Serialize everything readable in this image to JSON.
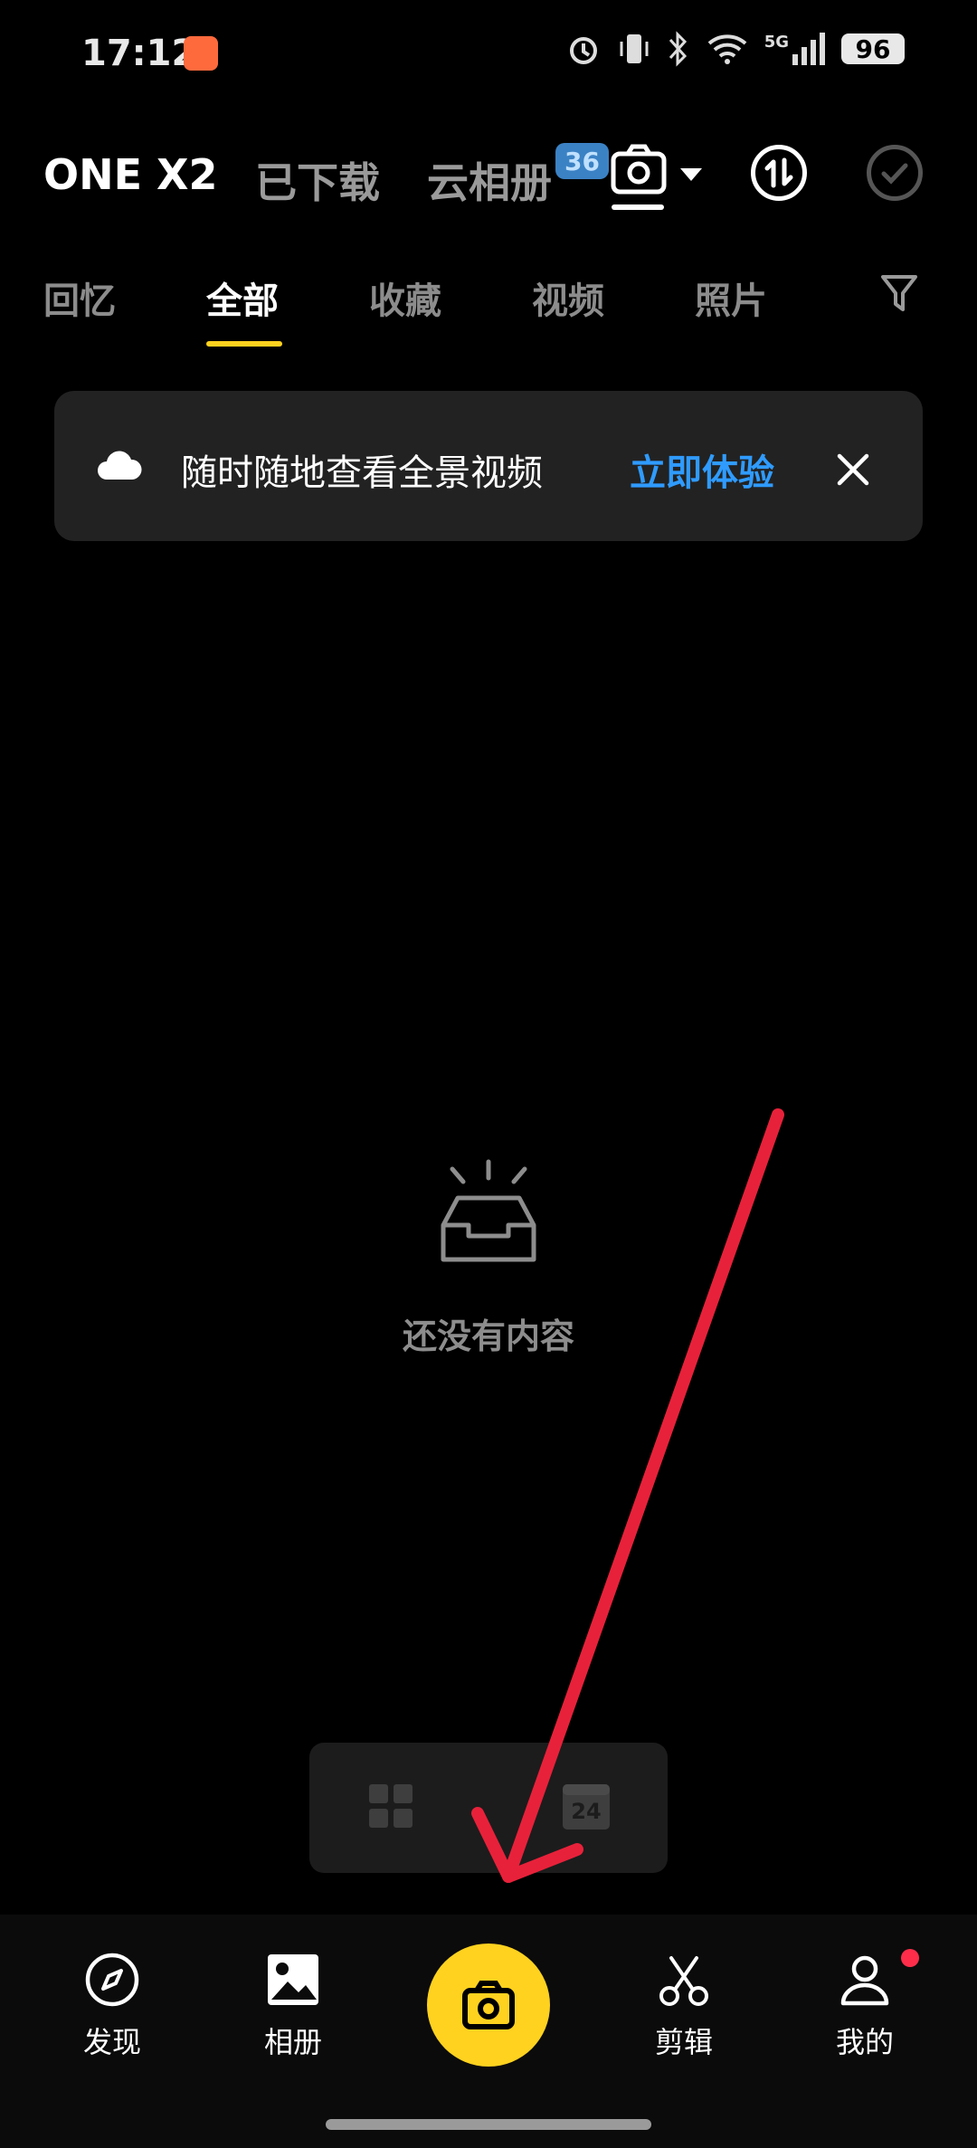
{
  "status": {
    "time": "17:12",
    "battery": "96",
    "network": "5G"
  },
  "header": {
    "tabs": [
      "ONE X2",
      "已下载",
      "云相册"
    ],
    "cloud_badge": "36"
  },
  "subtabs": [
    "回忆",
    "全部",
    "收藏",
    "视频",
    "照片"
  ],
  "banner": {
    "text": "随时随地查看全景视频",
    "action": "立即体验"
  },
  "empty": {
    "text": "还没有内容"
  },
  "view_toggle": {
    "calendar_day": "24"
  },
  "nav": {
    "items": [
      {
        "label": "发现",
        "icon": "compass-icon"
      },
      {
        "label": "相册",
        "icon": "image-icon"
      },
      {
        "label": "剪辑",
        "icon": "scissors-icon"
      },
      {
        "label": "我的",
        "icon": "user-icon"
      }
    ]
  },
  "colors": {
    "accent": "#ffd21f",
    "link": "#2f9bff",
    "annotation_arrow": "#e8213a"
  }
}
